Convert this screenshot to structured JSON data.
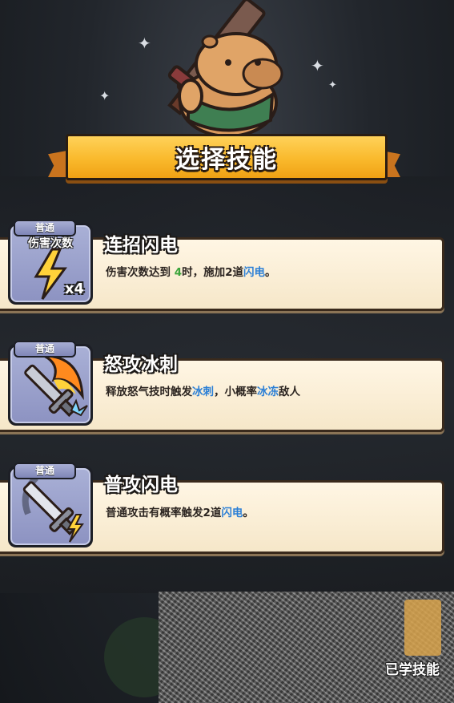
{
  "title": "选择技能",
  "skills": [
    {
      "name": "连招闪电",
      "rarity": "普通",
      "icon_label": "伤害次数",
      "icon_count": "x4",
      "icon": "lightning-bolt-icon",
      "desc": {
        "p1": "伤害次数达到 ",
        "h1": "4",
        "p2": "时，施加2道",
        "h2": "闪电",
        "p3": "。"
      },
      "highlight_colors": {
        "number": "#3aa43a",
        "keyword": "#2b7fd6"
      }
    },
    {
      "name": "怒攻冰刺",
      "rarity": "普通",
      "icon": "flaming-sword-icon",
      "desc": {
        "p1": "释放怒气技时触发",
        "h1": "冰刺",
        "p2": "，小概率",
        "h2": "冰冻",
        "p3": "敌人"
      }
    },
    {
      "name": "普攻闪电",
      "rarity": "普通",
      "icon": "sword-lightning-icon",
      "desc": {
        "p1": "普通攻击有概率触发2道",
        "h1": "闪电",
        "p2": "。"
      }
    }
  ],
  "learned_skills_label": "已学技能",
  "colors": {
    "banner": "#f9b92c",
    "card": "#fff6e4",
    "rarity_badge": "#8d93c2"
  }
}
